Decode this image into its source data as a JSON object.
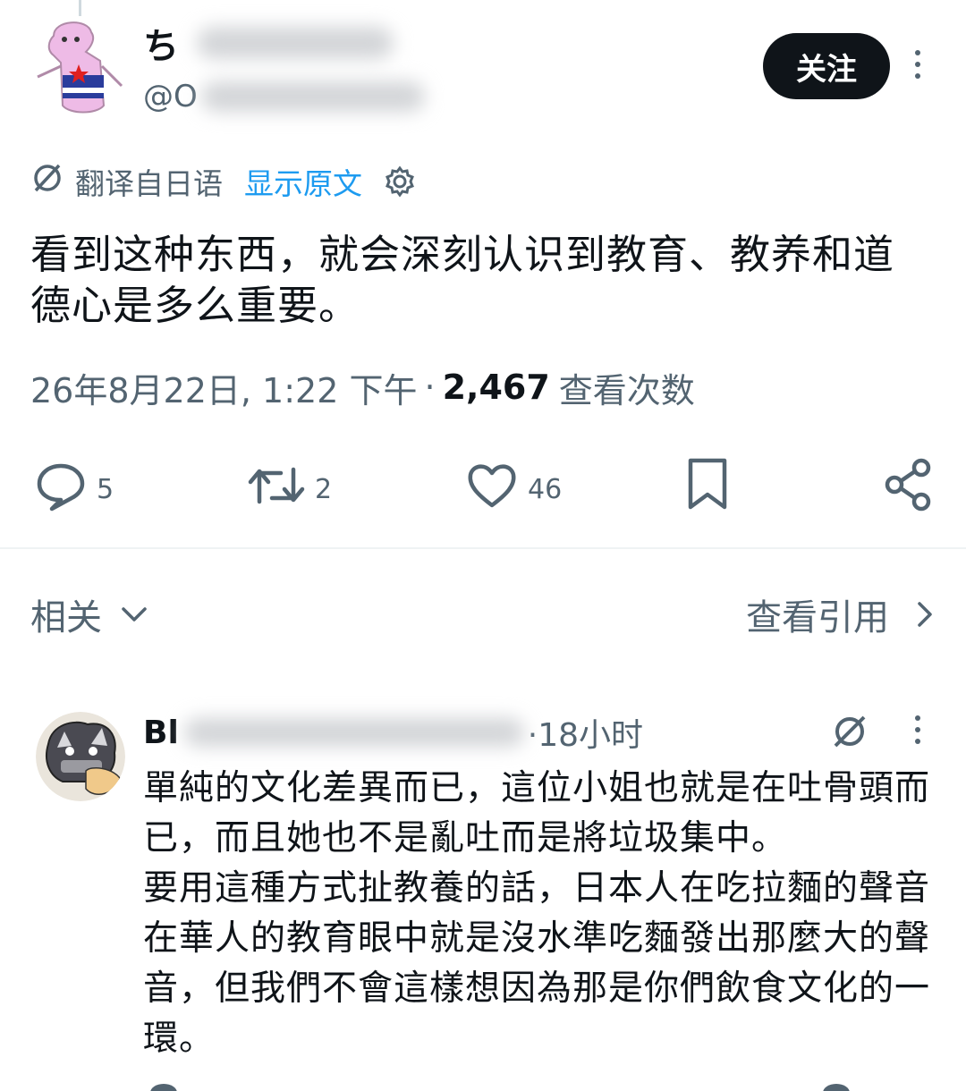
{
  "author": {
    "name_visible": "ち",
    "handle_visible": "@O",
    "follow_label": "关注"
  },
  "translation": {
    "label": "翻译自日语",
    "show_original": "显示原文"
  },
  "tweet": {
    "text": "看到这种东西，就会深刻认识到教育、教养和道德心是多么重要。",
    "date": "26年8月22日, 1:22 下午",
    "separator": "·",
    "views_count": "2,467",
    "views_label": "查看次数"
  },
  "actions": {
    "replies": "5",
    "retweets": "2",
    "likes": "46"
  },
  "related": {
    "label": "相关",
    "view_quotes": "查看引用"
  },
  "reply": {
    "name_visible": "Bl",
    "time": "·18小时",
    "text": "單純的文化差異而已，這位小姐也就是在吐骨頭而已，而且她也不是亂吐而是將垃圾集中。\n要用這種方式扯教養的話，日本人在吃拉麵的聲音在華人的教育眼中就是沒水準吃麵發出那麼大的聲音，但我們不會這樣想因為那是你們飲食文化的一環。"
  },
  "icons": [
    "more-icon",
    "translate-icon",
    "settings-icon",
    "reply-icon",
    "retweet-icon",
    "like-icon",
    "bookmark-icon",
    "share-icon",
    "chevron-down-icon",
    "chevron-right-icon",
    "grok-icon"
  ],
  "colors": {
    "text": "#0f1419",
    "secondary": "#536471",
    "link": "#1d9bf0",
    "button": "#0f1419"
  }
}
